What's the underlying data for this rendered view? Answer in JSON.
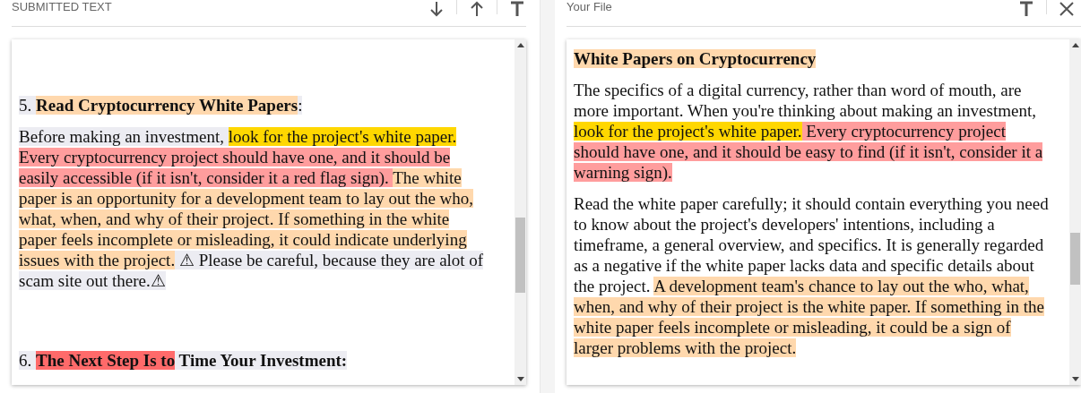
{
  "panels": [
    {
      "title": "SUBMITTED TEXT",
      "icons": [
        {
          "kind": "arrow-down"
        },
        {
          "kind": "arrow-up"
        },
        {
          "kind": "text"
        }
      ],
      "paragraphs": [
        {
          "segments": [
            {
              "text": "5. ",
              "color": "#ececf2"
            },
            {
              "text": "Read Cryptocurrency White Papers",
              "bold": true,
              "color": "#ffd8ad"
            },
            {
              "text": ":",
              "color": "#ececf2"
            }
          ]
        },
        {
          "segments": [
            {
              "text": "Before making an investment, ",
              "color": "#ececf2"
            },
            {
              "text": "look for the project's white paper. ",
              "color": "#ffd700"
            },
            {
              "text": "Every cryptocurrency project should have one, and it should be easily accessible (if it isn't, consider it a red flag sign). ",
              "color": "#ff9d9d"
            },
            {
              "text": "The white paper is an opportunity for a development team to lay out the who, what, when, and why of their project. ",
              "color": "#ffd8ad"
            },
            {
              "text": "If something in the white paper feels incomplete or misleading, it could indicate underlying issues with the project.",
              "color": "#ffd8ad"
            },
            {
              "text": " ⚠ Please be careful, because they are alot of scam site out there.⚠",
              "color": "#ececf2"
            }
          ]
        },
        {
          "segments": [
            {
              "text": "6. ",
              "color": "#ececf2"
            },
            {
              "text": "The Next Step Is to",
              "bold": true,
              "color": "#ff6a6a"
            },
            {
              "text": " Time Your Investment:",
              "bold": true,
              "color": "#ececf2"
            }
          ]
        }
      ]
    },
    {
      "title": "Your File",
      "icons": [
        {
          "kind": "text"
        },
        {
          "kind": "close"
        }
      ],
      "paragraphs": [
        {
          "segments": [
            {
              "text": "White Papers on Cryptocurrency",
              "bold": true,
              "color": "#ffd8ad"
            }
          ]
        },
        {
          "segments": [
            {
              "text": "The specifics of a digital currency, rather than word of mouth, are more important. When you're thinking about making an investment, "
            },
            {
              "text": "look for the project's white paper.",
              "color": "#ffd700"
            },
            {
              "text": " Every cryptocurrency project should have one, and it should be easy to find (if it isn't, consider it a warning sign).",
              "color": "#ff9d9d"
            }
          ]
        },
        {
          "segments": [
            {
              "text": "Read the white paper carefully; it should contain everything you need to know about the project's developers' intentions, including a timeframe, a general overview, and specifics. It is generally regarded as a negative if the white paper lacks data and specific details about the project. "
            },
            {
              "text": "A development team's chance to lay out the who, what, when, and why of their project is the white paper. ",
              "color": "#ffd8ad"
            },
            {
              "text": "If something in the white paper feels incomplete or misleading, it could be a sign of larger problems with the project.",
              "color": "#ffd8ad"
            }
          ]
        }
      ]
    }
  ]
}
